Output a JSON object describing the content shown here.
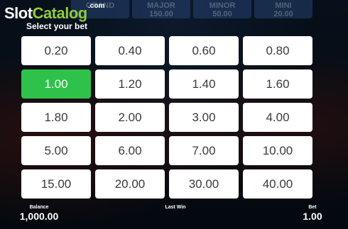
{
  "logo": {
    "part1": "Slot",
    "part2": "Catalog",
    "suffix": ".com"
  },
  "jackpots": [
    {
      "name": "GRAND",
      "value": ""
    },
    {
      "name": "MAJOR",
      "value": "150.00"
    },
    {
      "name": "MINOR",
      "value": "50.00"
    },
    {
      "name": "MINI",
      "value": "20.00"
    }
  ],
  "title": "Select your bet",
  "bets": [
    {
      "label": "0.20",
      "selected": false
    },
    {
      "label": "0.40",
      "selected": false
    },
    {
      "label": "0.60",
      "selected": false
    },
    {
      "label": "0.80",
      "selected": false
    },
    {
      "label": "1.00",
      "selected": true
    },
    {
      "label": "1.20",
      "selected": false
    },
    {
      "label": "1.40",
      "selected": false
    },
    {
      "label": "1.60",
      "selected": false
    },
    {
      "label": "1.80",
      "selected": false
    },
    {
      "label": "2.00",
      "selected": false
    },
    {
      "label": "3.00",
      "selected": false
    },
    {
      "label": "4.00",
      "selected": false
    },
    {
      "label": "5.00",
      "selected": false
    },
    {
      "label": "6.00",
      "selected": false
    },
    {
      "label": "7.00",
      "selected": false
    },
    {
      "label": "10.00",
      "selected": false
    },
    {
      "label": "15.00",
      "selected": false
    },
    {
      "label": "20.00",
      "selected": false
    },
    {
      "label": "30.00",
      "selected": false
    },
    {
      "label": "40.00",
      "selected": false
    }
  ],
  "footer": {
    "balance_label": "Balance",
    "balance_value": "1,000.00",
    "lastwin_label": "Last Win",
    "lastwin_value": "",
    "bet_label": "Bet",
    "bet_value": "1.00"
  },
  "colors": {
    "selected": "#2fc24b",
    "button": "#ffffff",
    "logo_accent": "#8fcb3c"
  }
}
